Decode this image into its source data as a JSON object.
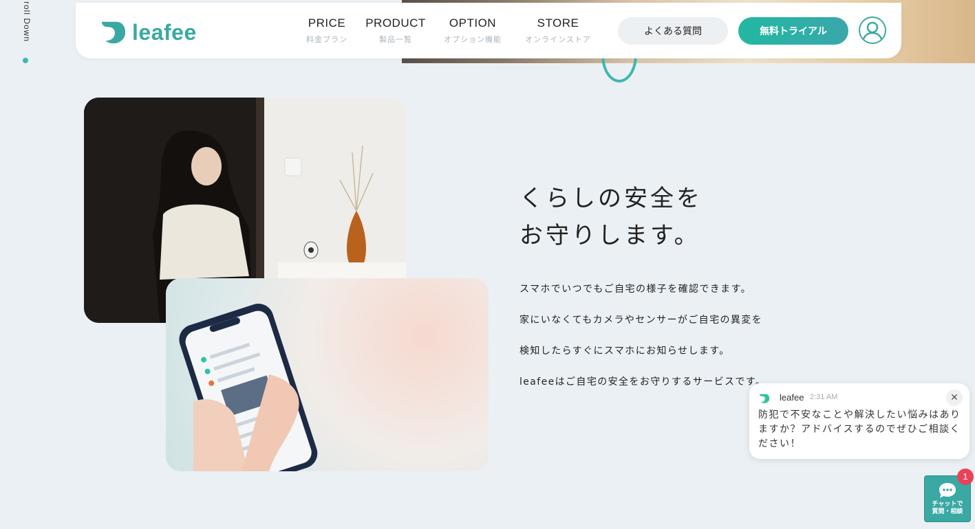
{
  "scroll_hint": "roll Down",
  "brand": {
    "name": "leafee",
    "color": "#3aa8a3"
  },
  "nav": [
    {
      "en": "PRICE",
      "jp": "料金プラン"
    },
    {
      "en": "PRODUCT",
      "jp": "製品一覧"
    },
    {
      "en": "OPTION",
      "jp": "オプション機能"
    },
    {
      "en": "STORE",
      "jp": "オンラインストア"
    }
  ],
  "header_buttons": {
    "faq": "よくある質問",
    "trial": "無料トライアル"
  },
  "section": {
    "headline_line1": "くらしの安全を",
    "headline_line2": "お守りします。",
    "paragraphs": [
      "スマホでいつでもご自宅の様子を確認できます。",
      "家にいなくてもカメラやセンサーがご自宅の異変を",
      "検知したらすぐにスマホにお知らせします。",
      "leafeeはご自宅の安全をお守りするサービスです。"
    ]
  },
  "chat": {
    "brand": "leafee",
    "time": "2:31 AM",
    "message": "防犯で不安なことや解決したい悩みはありますか？アドバイスするのでぜひご相談ください！",
    "button_line1": "チャットで",
    "button_line2": "質問・相談",
    "badge": "1"
  }
}
